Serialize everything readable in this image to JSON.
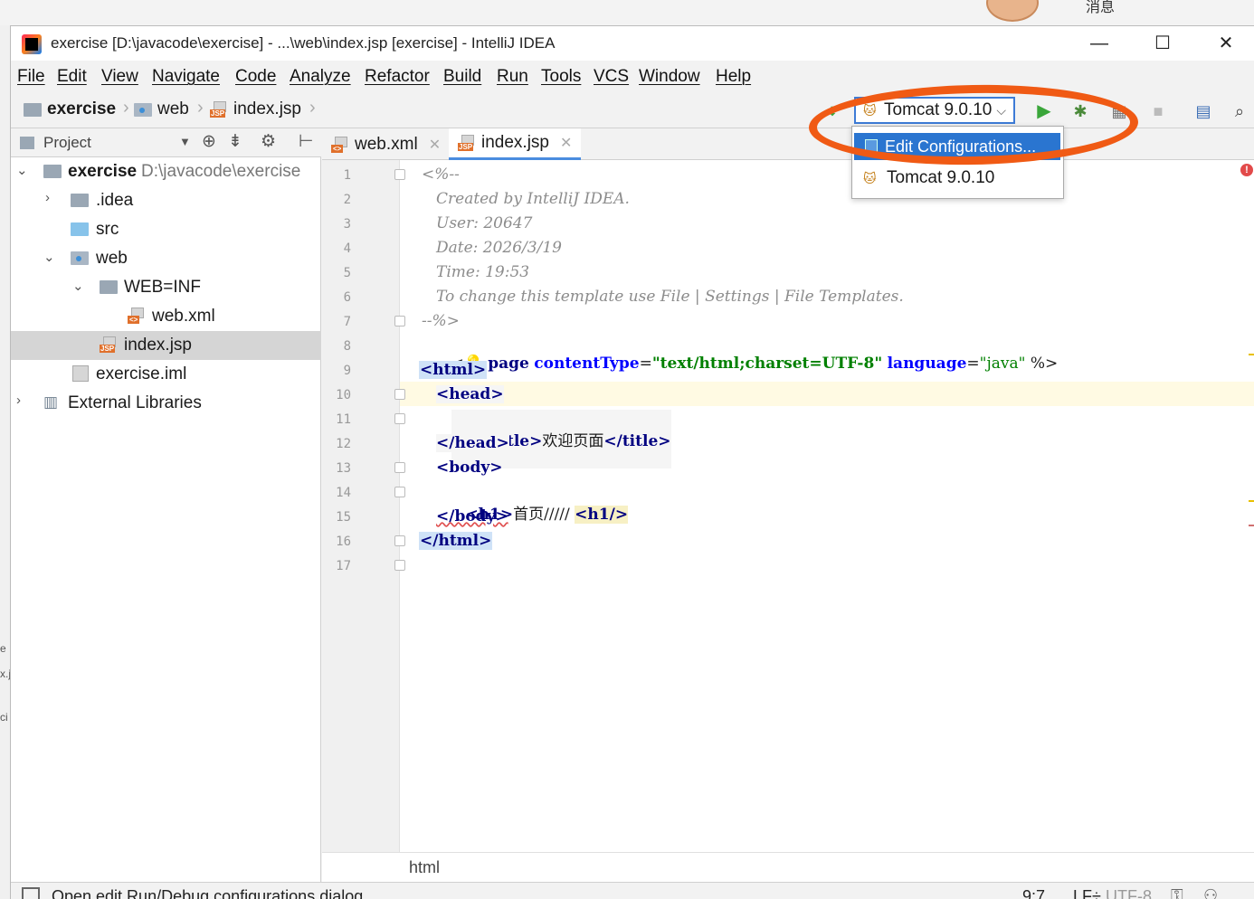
{
  "desktop": {
    "corner_text": "消息"
  },
  "window": {
    "title": "exercise [D:\\javacode\\exercise] - ...\\web\\index.jsp [exercise] - IntelliJ IDEA",
    "controls": {
      "minimize": "—",
      "maximize": "☐",
      "close": "✕"
    }
  },
  "menu": [
    "File",
    "Edit",
    "View",
    "Navigate",
    "Code",
    "Analyze",
    "Refactor",
    "Build",
    "Run",
    "Tools",
    "VCS",
    "Window",
    "Help"
  ],
  "navbar": {
    "crumbs": [
      "exercise",
      "web",
      "index.jsp"
    ],
    "run_config": "Tomcat 9.0.10"
  },
  "project_panel": {
    "header": "Project",
    "tree": [
      {
        "label": "exercise",
        "path": "D:\\javacode\\exercise",
        "icon": "module-folder-icon"
      },
      {
        "label": ".idea",
        "icon": "folder-icon"
      },
      {
        "label": "src",
        "icon": "source-folder-icon"
      },
      {
        "label": "web",
        "icon": "web-folder-icon"
      },
      {
        "label": "WEB=INF",
        "icon": "folder-icon"
      },
      {
        "label": "web.xml",
        "icon": "xml-file-icon"
      },
      {
        "label": "index.jsp",
        "icon": "jsp-file-icon"
      },
      {
        "label": "exercise.iml",
        "icon": "iml-file-icon"
      },
      {
        "label": "External Libraries",
        "icon": "libraries-icon"
      }
    ]
  },
  "tabs": [
    {
      "label": "web.xml",
      "active": false
    },
    {
      "label": "index.jsp",
      "active": true
    }
  ],
  "editor": {
    "line_numbers": [
      "1",
      "2",
      "3",
      "4",
      "5",
      "6",
      "7",
      "8",
      "9",
      "10",
      "11",
      "12",
      "13",
      "14",
      "15",
      "16",
      "17"
    ],
    "lines": {
      "l1": "<%--",
      "l2": "Created by IntelliJ IDEA.",
      "l3": "User: 20647",
      "l4": "Date: 2026/3/19",
      "l5": "Time: 19:53",
      "l6": "To change this template use File | Settings | File Templates.",
      "l7": "--%>",
      "l8_open": "<",
      "l8_directive": "page",
      "l8_attr1": "contentType",
      "l8_val1": "\"text/html;charset=UTF-8\"",
      "l8_attr2": "language",
      "l8_val2": "\"java\"",
      "l8_close": "%>",
      "l9": "<html>",
      "l10": "<head>",
      "l11_open": "<title>",
      "l11_text": "欢迎页面",
      "l11_close": "</title>",
      "l12": "</head>",
      "l13": "<body>",
      "l14_open": "<h1>",
      "l14_text": "首页/////",
      "l14_close": "<h1/>",
      "l15": "</body>",
      "l16": "</html>"
    }
  },
  "dropdown": {
    "items": [
      "Edit Configurations...",
      "Tomcat 9.0.10"
    ]
  },
  "bottom_breadcrumb": "html",
  "statusbar": {
    "message": "Open edit Run/Debug configurations dialog",
    "position": "9:7",
    "line_sep": "LF÷",
    "encoding": "UTF-8"
  },
  "colors": {
    "accent": "#2a75d0",
    "annotation": "#f05a14",
    "run_green": "#3aa63a"
  }
}
